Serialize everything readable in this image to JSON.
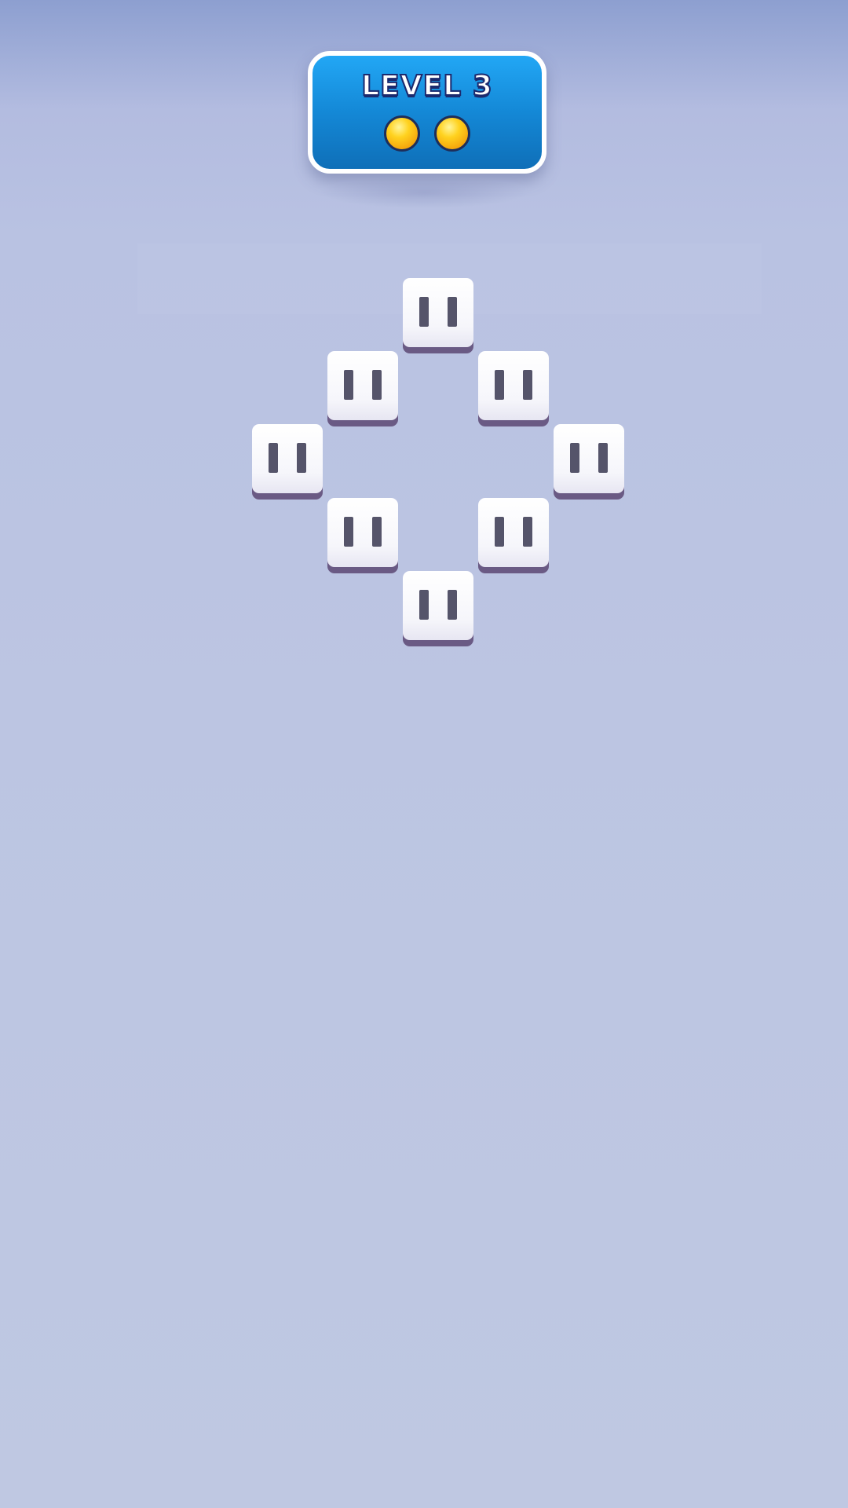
{
  "hud": {
    "level_label": "LEVEL 3",
    "coins_shown": 2,
    "coin_color": "#ffc91a"
  },
  "board": {
    "tile_count": 8,
    "tile_face_color": "#ffffff",
    "tile_base_color": "#6a5a84",
    "tile_eye_color": "#55546a",
    "arrangement": "diamond"
  },
  "background": {
    "top_color": "#8d9fd0",
    "bottom_color": "#bfc8e2"
  }
}
